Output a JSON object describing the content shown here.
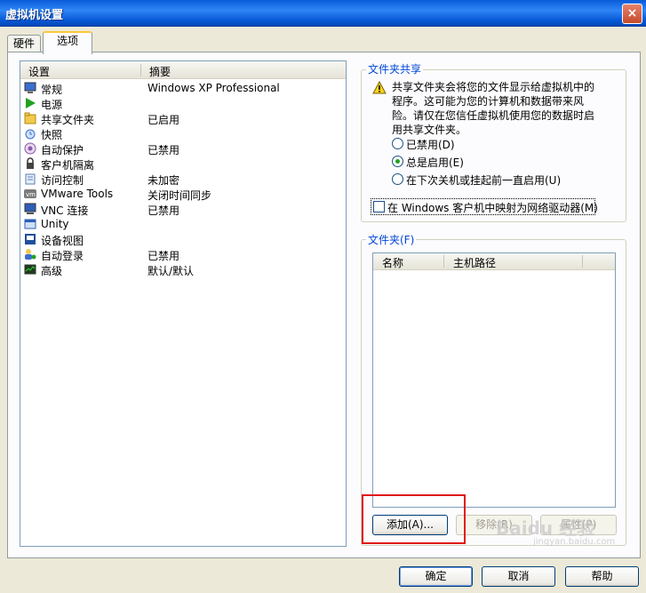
{
  "window": {
    "title": "虚拟机设置",
    "close_glyph": "×"
  },
  "tabs": [
    {
      "label": "硬件",
      "active": false
    },
    {
      "label": "选项",
      "active": true
    }
  ],
  "settings_list": {
    "headers": {
      "setting": "设置",
      "summary": "摘要"
    },
    "rows": [
      {
        "name": "常规",
        "summary": "Windows XP Professional",
        "icon": "monitor-icon",
        "selected": true
      },
      {
        "name": "电源",
        "summary": "",
        "icon": "power-play-icon"
      },
      {
        "name": "共享文件夹",
        "summary": "已启用",
        "icon": "shared-folder-icon"
      },
      {
        "name": "快照",
        "summary": "",
        "icon": "snapshot-icon"
      },
      {
        "name": "自动保护",
        "summary": "已禁用",
        "icon": "autoprotect-icon"
      },
      {
        "name": "客户机隔离",
        "summary": "",
        "icon": "lock-icon"
      },
      {
        "name": "访问控制",
        "summary": "未加密",
        "icon": "access-control-icon"
      },
      {
        "name": "VMware Tools",
        "summary": "关闭时间同步",
        "icon": "vmware-tools-icon"
      },
      {
        "name": "VNC 连接",
        "summary": "已禁用",
        "icon": "vnc-icon"
      },
      {
        "name": "Unity",
        "summary": "",
        "icon": "unity-icon"
      },
      {
        "name": "设备视图",
        "summary": "",
        "icon": "device-view-icon"
      },
      {
        "name": "自动登录",
        "summary": "已禁用",
        "icon": "autologin-icon"
      },
      {
        "name": "高级",
        "summary": "默认/默认",
        "icon": "advanced-icon"
      }
    ]
  },
  "folder_sharing": {
    "title": "文件夹共享",
    "warning": "共享文件夹会将您的文件显示给虚拟机中的程序。这可能为您的计算机和数据带来风险。请仅在您信任虚拟机使用您的数据时启用共享文件夹。",
    "options": [
      {
        "label": "已禁用(D)",
        "checked": false
      },
      {
        "label": "总是启用(E)",
        "checked": true
      },
      {
        "label": "在下次关机或挂起前一直启用(U)",
        "checked": false
      }
    ],
    "map_drive_label": "在 Windows 客户机中映射为网络驱动器(M)",
    "map_drive_checked": false
  },
  "folders": {
    "title": "文件夹(F)",
    "headers": {
      "name": "名称",
      "host_path": "主机路径"
    },
    "items": [],
    "buttons": {
      "add": "添加(A)...",
      "remove": "移除(R)",
      "properties": "属性(P)"
    }
  },
  "footer": {
    "ok": "确定",
    "cancel": "取消",
    "help": "帮助"
  },
  "watermark": {
    "text": "Baidu 经验",
    "sub": "jingyan.baidu.com"
  },
  "colors": {
    "title_bar": "#0a5bd9",
    "group_label": "#0046d5",
    "highlight": "#e01818",
    "selection": "#316ac5"
  }
}
